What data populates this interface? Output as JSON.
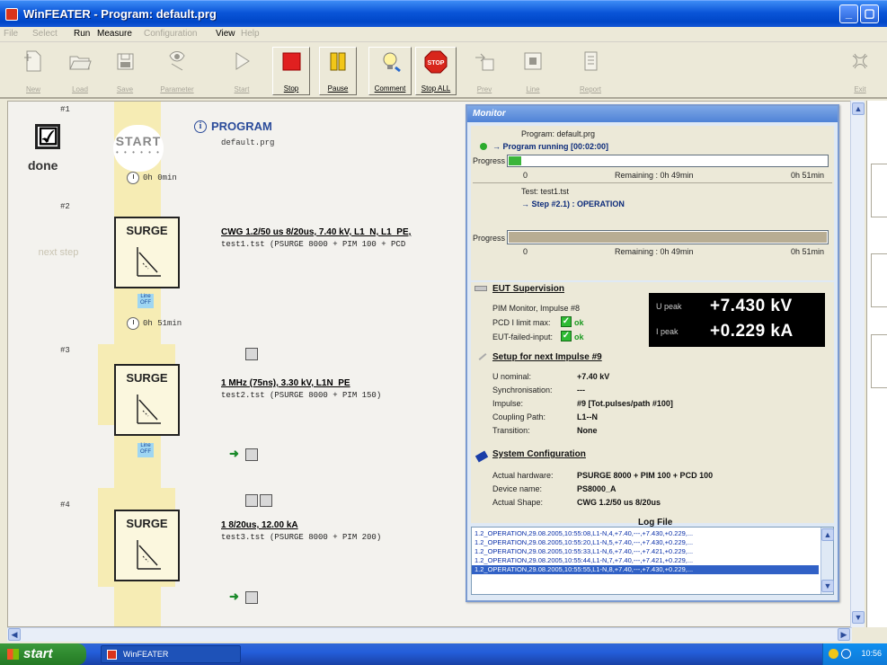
{
  "window": {
    "title": "WinFEATER - Program: default.prg"
  },
  "menu": {
    "items": [
      {
        "label": "File",
        "enabled": false
      },
      {
        "label": "Select",
        "enabled": false
      },
      {
        "label": "Run",
        "enabled": true
      },
      {
        "label": "Measure",
        "enabled": true
      },
      {
        "label": "Configuration",
        "enabled": false
      },
      {
        "label": "View",
        "enabled": true
      },
      {
        "label": "Help",
        "enabled": false
      }
    ]
  },
  "toolbar": {
    "new": "New",
    "load": "Load",
    "save": "Save",
    "parameter": "Parameter",
    "start": "Start",
    "stop": "Stop",
    "pause": "Pause",
    "comment": "Comment",
    "stop_all": "Stop ALL",
    "prev": "Prev",
    "line": "Line",
    "report": "Report",
    "exit": "Exit"
  },
  "program": {
    "title": "PROGRAM",
    "info_glyph": "i",
    "file": "default.prg",
    "start_label": "START",
    "start_dots": "• • • • • •",
    "done_check": "☑",
    "done_label": "done",
    "next_label": "next step",
    "steps": [
      {
        "num": "#1",
        "time": "0h 0min"
      },
      {
        "num": "#2",
        "header": "CWG 1.2/50 us 8/20us,  7.40 kV,  L1_N, L1_PE,",
        "file": "test1.tst  (PSURGE 8000 + PIM 100 + PCD",
        "time": "0h 51min",
        "line_label": "Line OFF"
      },
      {
        "num": "#3",
        "header": "1 MHz (75ns),  3.30 kV,  L1N_PE",
        "file": "test2.tst  (PSURGE 8000 + PIM 150)",
        "line_label": "Line OFF"
      },
      {
        "num": "#4",
        "header": "1 8/20us,  12.00 kA",
        "file": "test3.tst  (PSURGE 8000 + PIM 200)"
      }
    ],
    "surge_label": "SURGE"
  },
  "monitor": {
    "title": "Monitor",
    "program_label": "Program: default.prg",
    "program_status": "→ Program running [00:02:00]",
    "progress_label": "Progress",
    "progress1": {
      "fraction": 0.04,
      "start": "0",
      "remaining": "Remaining : 0h 49min",
      "end": "0h 51min"
    },
    "test_label": "Test: test1.tst",
    "step_label": "→ Step #2.1) : OPERATION",
    "progress2": {
      "fraction": 0.01,
      "start": "0",
      "remaining": "Remaining : 0h 49min",
      "end": "0h 51min"
    },
    "eut": {
      "title": "EUT Supervision",
      "pim_monitor": "PIM Monitor, Impulse #8",
      "pcd_label": "PCD I limit max:",
      "pcd_value": "ok",
      "eut_label": "EUT-failed-input:",
      "eut_value": "ok",
      "check_glyph": "✓"
    },
    "readout": {
      "u_label": "U peak",
      "u_value": "+7.430 kV",
      "i_label": "I peak",
      "i_value": "+0.229 kA"
    },
    "setup": {
      "title": "Setup for next Impulse  #9",
      "rows": [
        {
          "label": "U nominal:",
          "value": "+7.40 kV"
        },
        {
          "label": "Synchronisation:",
          "value": "---"
        },
        {
          "label": "Impulse:",
          "value": "#9  [Tot.pulses/path #100]"
        },
        {
          "label": "Coupling Path:",
          "value": "L1--N"
        },
        {
          "label": "Transition:",
          "value": "None"
        }
      ]
    },
    "system": {
      "title": "System Configuration",
      "rows": [
        {
          "label": "Actual hardware:",
          "value": "PSURGE 8000 + PIM 100 + PCD 100"
        },
        {
          "label": "Device name:",
          "value": "PS8000_A"
        },
        {
          "label": "Actual Shape:",
          "value": "CWG 1.2/50 us 8/20us"
        }
      ]
    },
    "log": {
      "title": "Log File",
      "lines": [
        "1.2_OPERATION,29.08.2005,10:55:08,L1-N,4,+7.40,---,+7.430,+0.229,...",
        "1.2_OPERATION,29.08.2005,10:55:20,L1-N,5,+7.40,---,+7.430,+0.229,...",
        "1.2_OPERATION,29.08.2005,10:55:33,L1-N,6,+7.40,---,+7.421,+0.229,...",
        "1.2_OPERATION,29.08.2005,10:55:44,L1-N,7,+7.40,---,+7.421,+0.229,...",
        "1.2_OPERATION,29.08.2005,10:55:55,L1-N,8,+7.40,---,+7.430,+0.229,..."
      ],
      "selected_index": 4
    }
  },
  "taskbar": {
    "start_label": "start",
    "task_label": "WinFEATER",
    "clock": "10:56"
  },
  "colors": {
    "stop_red": "#e02020",
    "pause_yellow": "#f2c618",
    "progress_green": "#3bb53b",
    "progress_tan": "#b8ad93"
  }
}
